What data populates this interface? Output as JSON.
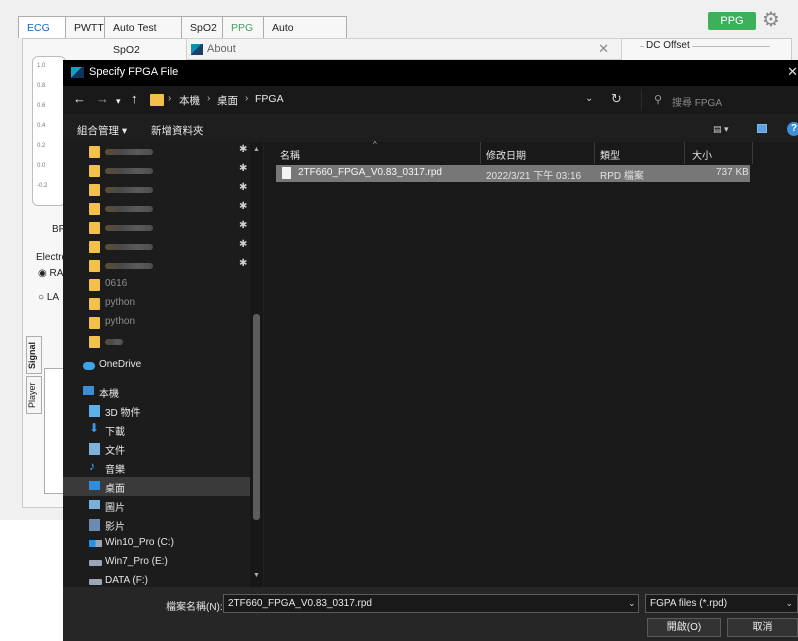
{
  "background_app": {
    "tabs": [
      "ECG",
      "PWTT",
      "Auto Test SpO2",
      "SpO2",
      "PPG",
      "Auto Sequence"
    ],
    "ppg_button": "PPG",
    "about_title": "About",
    "dc_offset": "DC Offset",
    "bp_label": "BP",
    "electrode_label": "Electro",
    "radio_ra": "RA",
    "radio_la": "LA",
    "side_tab_signal": "Signal",
    "side_tab_player": "Player"
  },
  "dialog": {
    "title": "Specify FPGA File",
    "breadcrumb": [
      "本機",
      "桌面",
      "FPGA"
    ],
    "search_placeholder": "搜尋 FPGA",
    "toolbar": {
      "organize": "組合管理 ▾",
      "new_folder": "新增資料夾"
    },
    "nav": {
      "folder_06": "0616",
      "python_1": "python",
      "python_2": "python",
      "onedrive": "OneDrive",
      "this_pc": "本機",
      "objects_3d": "3D 物件",
      "downloads": "下載",
      "documents": "文件",
      "music": "音樂",
      "desktop": "桌面",
      "pictures": "圖片",
      "videos": "影片",
      "drive_c": "Win10_Pro (C:)",
      "drive_e": "Win7_Pro (E:)",
      "drive_f": "DATA (F:)"
    },
    "columns": {
      "name": "名稱",
      "modified": "修改日期",
      "type": "類型",
      "size": "大小"
    },
    "files": [
      {
        "name": "2TF660_FPGA_V0.83_0317.rpd",
        "modified": "2022/3/21 下午 03:16",
        "type": "RPD 檔案",
        "size": "737 KB"
      }
    ],
    "filename_label": "檔案名稱(N):",
    "filename_value": "2TF660_FPGA_V0.83_0317.rpd",
    "filter": "FGPA files (*.rpd)",
    "open_button": "開啟(O)",
    "cancel_button": "取消"
  }
}
